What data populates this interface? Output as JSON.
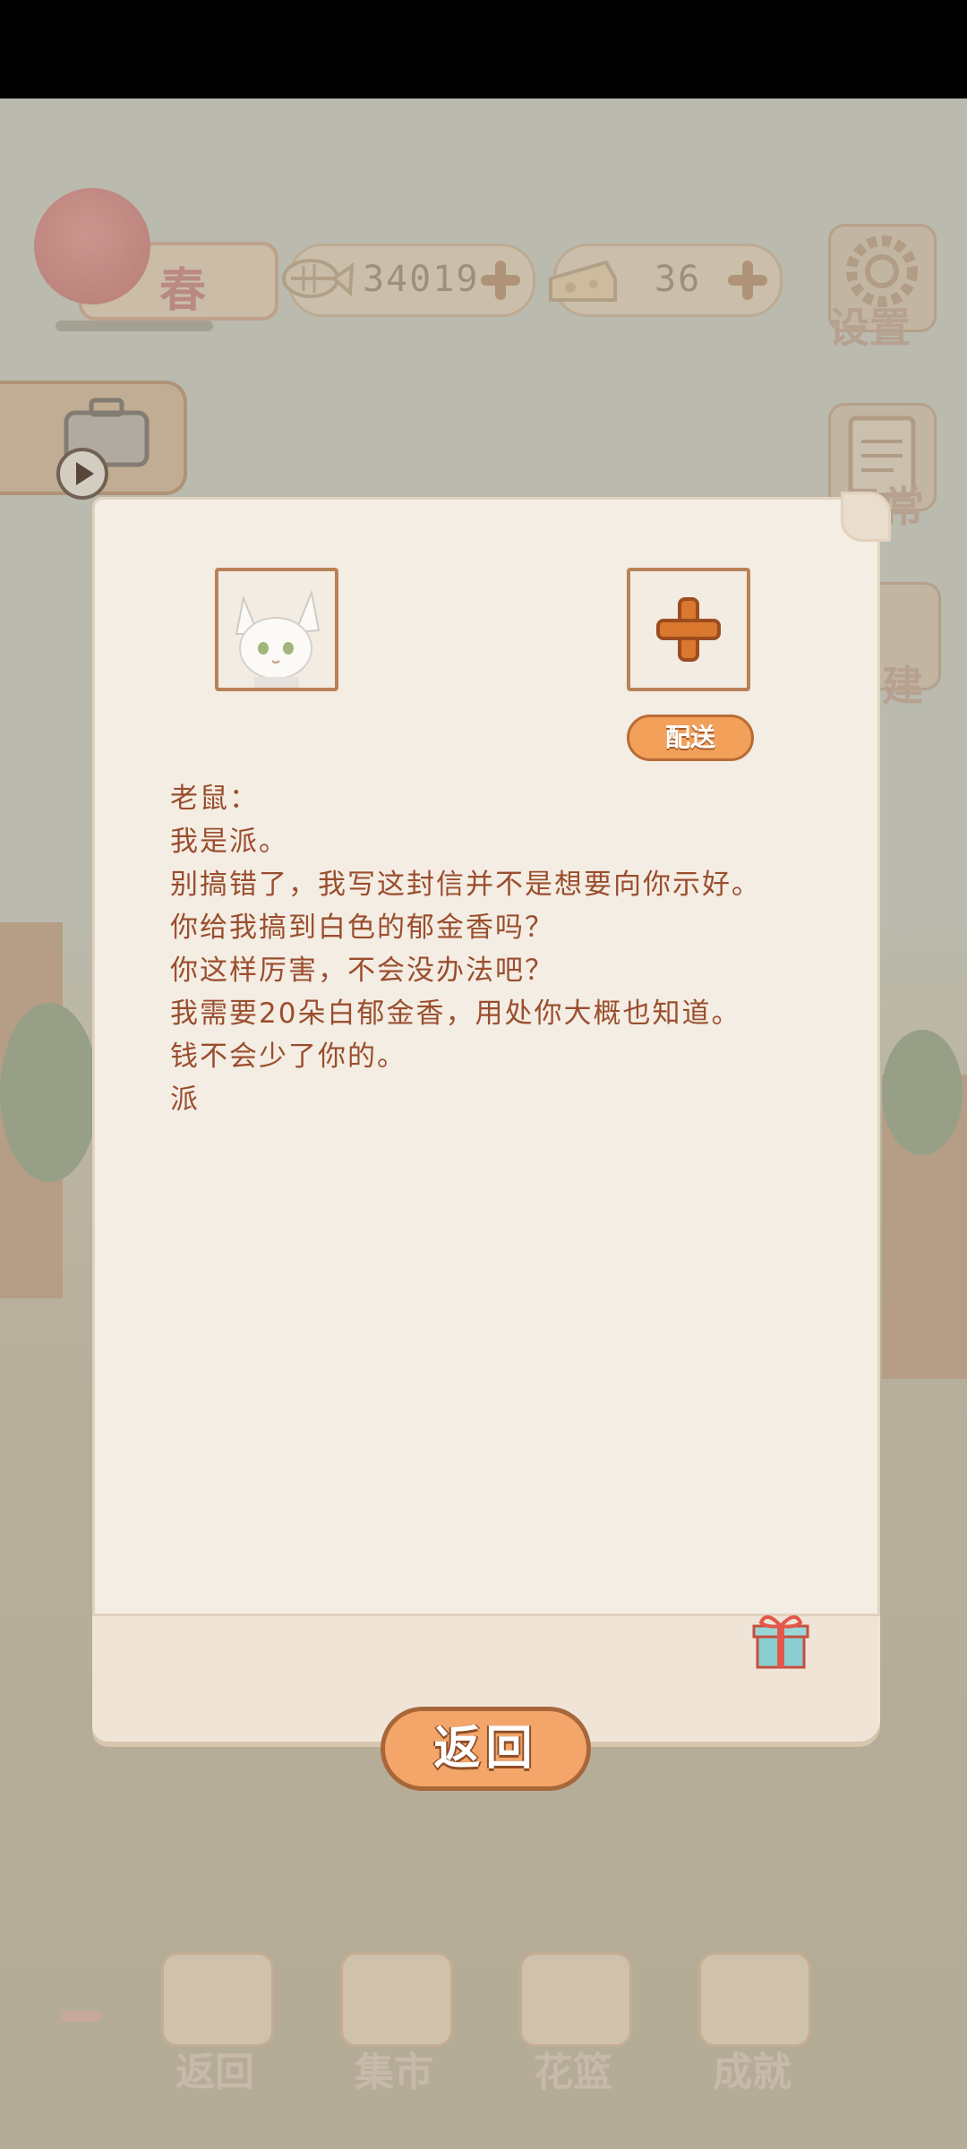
{
  "hud": {
    "season_label": "春",
    "fish_count": "34019",
    "cheese_count": "36",
    "settings_label": "设置",
    "daily_label": "日常",
    "build_label": "建"
  },
  "letter": {
    "deliver_label": "配送",
    "lines": [
      "老鼠：",
      "我是派。",
      "别搞错了，我写这封信并不是想要向你示好。",
      "你给我搞到白色的郁金香吗？",
      "你这样厉害，不会没办法吧？",
      "我需要20朵白郁金香，用处你大概也知道。",
      "钱不会少了你的。",
      "派"
    ],
    "back_label": "返回"
  },
  "nav": {
    "items": [
      {
        "label": "返回"
      },
      {
        "label": "集市"
      },
      {
        "label": "花篮"
      },
      {
        "label": "成就"
      }
    ]
  },
  "colors": {
    "letter_text": "#9a4e2e",
    "button_orange": "#f4a66a",
    "frame_brown": "#b88257"
  }
}
